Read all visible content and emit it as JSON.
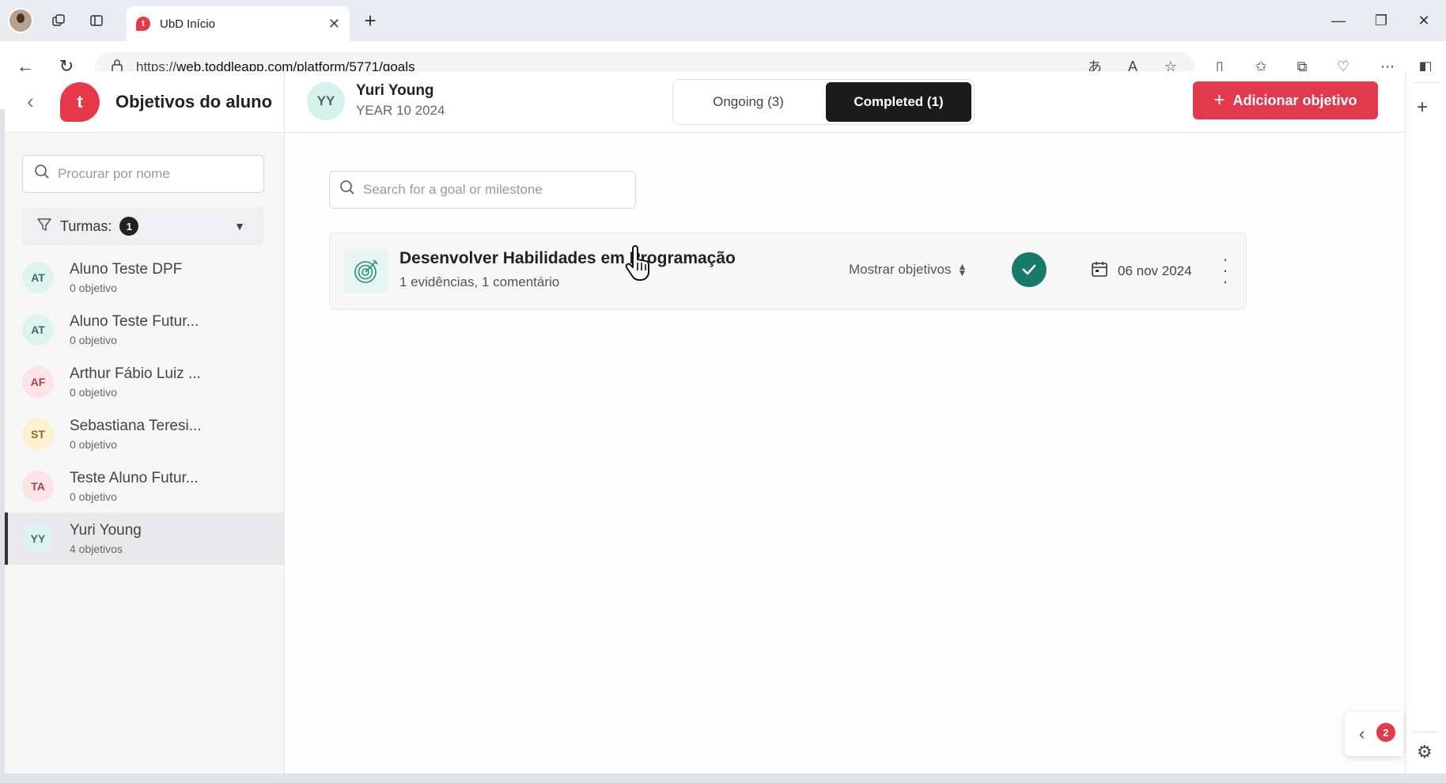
{
  "browser": {
    "tab_title": "UbD Início",
    "url_prefix": "https://",
    "url_main": "web.toddleapp.com/platform/5771/goals"
  },
  "sidebar": {
    "title": "Objetivos do aluno",
    "logo_letter": "t",
    "search_placeholder": "Procurar por nome",
    "filter_label": "Turmas:",
    "filter_count": "1",
    "students": [
      {
        "initials": "AT",
        "name": "Aluno Teste DPF",
        "count": "0 objetivo",
        "bg": "#dff3ee",
        "fg": "#3e6e63"
      },
      {
        "initials": "AT",
        "name": "Aluno Teste Futur...",
        "count": "0 objetivo",
        "bg": "#dff3ee",
        "fg": "#3e6e63"
      },
      {
        "initials": "AF",
        "name": "Arthur Fábio Luiz ...",
        "count": "0 objetivo",
        "bg": "#fbe3e6",
        "fg": "#a3414f"
      },
      {
        "initials": "ST",
        "name": "Sebastiana Teresi...",
        "count": "0 objetivo",
        "bg": "#fbf0cf",
        "fg": "#8b6d1e"
      },
      {
        "initials": "TA",
        "name": "Teste Aluno Futur...",
        "count": "0 objetivo",
        "bg": "#fbe3e6",
        "fg": "#a3414f"
      },
      {
        "initials": "YY",
        "name": "Yuri Young",
        "count": "4 objetivos",
        "bg": "#dff3ee",
        "fg": "#3e6e63"
      }
    ]
  },
  "header": {
    "student_initials": "YY",
    "student_name": "Yuri Young",
    "student_class": "YEAR 10 2024",
    "tab_ongoing": "Ongoing (3)",
    "tab_completed": "Completed (1)",
    "add_button": "Adicionar objetivo"
  },
  "main": {
    "search_placeholder": "Search for a goal or milestone",
    "goal": {
      "title": "Desenvolver Habilidades em Programação",
      "meta": "1 evidências, 1 comentário",
      "show_goals": "Mostrar objetivos",
      "date": "06 nov 2024"
    }
  },
  "float_badge": "2",
  "colors": {
    "accent": "#e23a4d",
    "success": "#177a6a",
    "dark": "#1b1b1b"
  }
}
